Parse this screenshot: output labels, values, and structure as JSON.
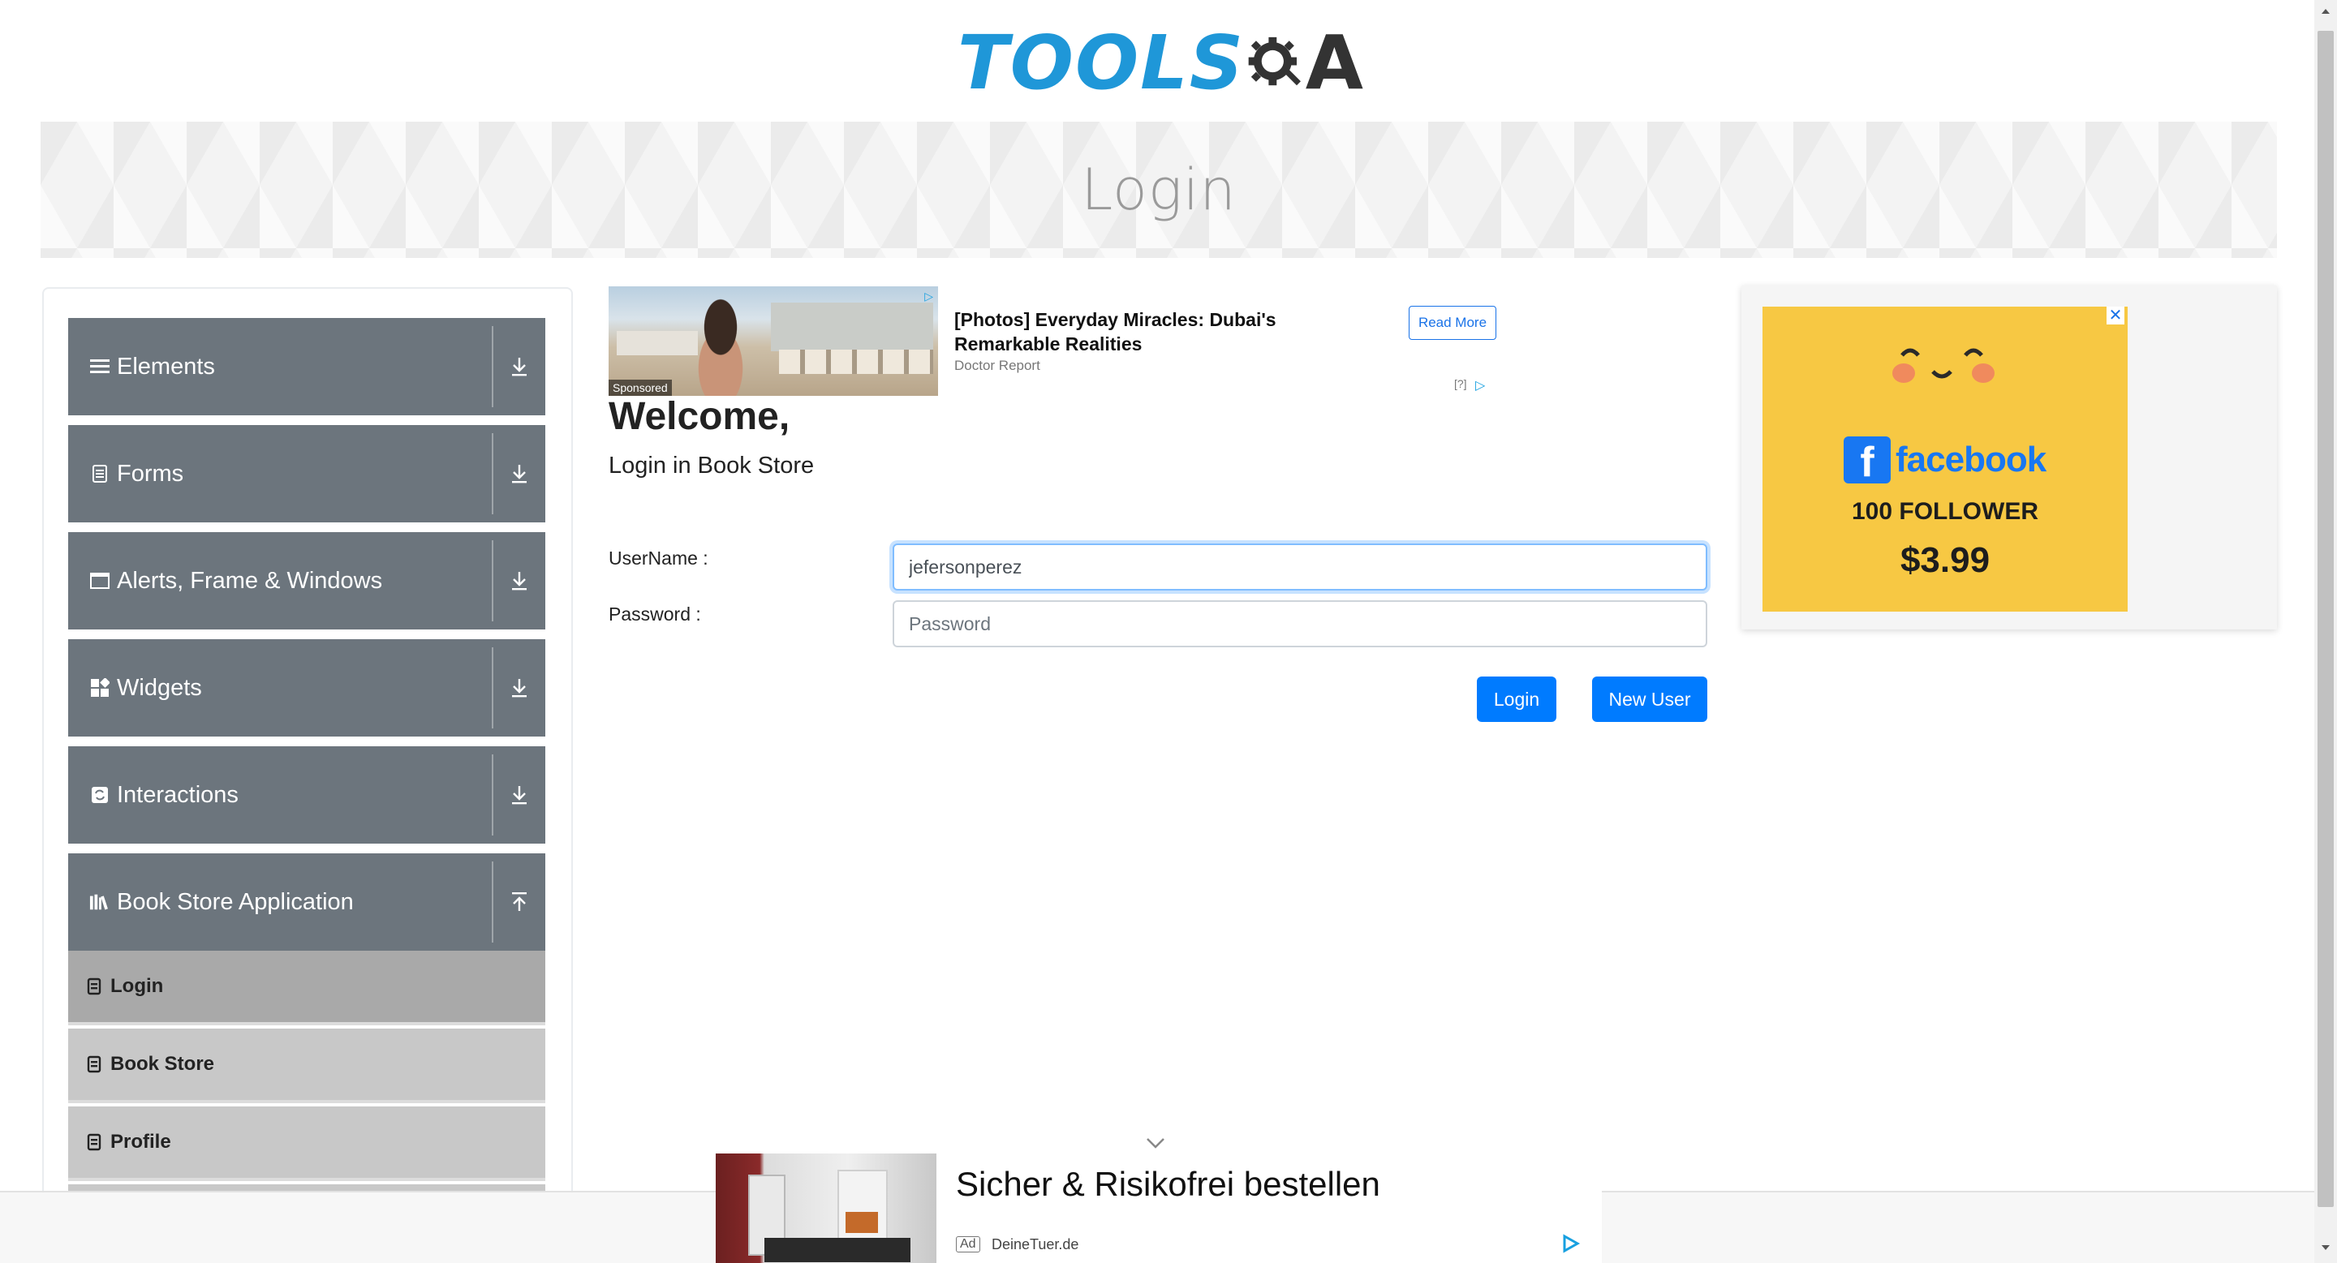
{
  "logo": {
    "text": "TOOLS",
    "a": "A"
  },
  "banner": {
    "title": "Login"
  },
  "sidebar": {
    "groups": [
      {
        "label": "Elements",
        "icon": "hamburger-icon"
      },
      {
        "label": "Forms",
        "icon": "form-icon"
      },
      {
        "label": "Alerts, Frame & Windows",
        "icon": "window-icon"
      },
      {
        "label": "Widgets",
        "icon": "widgets-icon"
      },
      {
        "label": "Interactions",
        "icon": "interactions-icon"
      },
      {
        "label": "Book Store Application",
        "icon": "books-icon"
      }
    ],
    "bookstore_items": [
      {
        "label": "Login",
        "active": true
      },
      {
        "label": "Book Store",
        "active": false
      },
      {
        "label": "Profile",
        "active": false
      }
    ]
  },
  "top_ad": {
    "headline": "[Photos] Everyday Miracles: Dubai's Remarkable Realities",
    "source": "Doctor Report",
    "button": "Read More",
    "sponsored": "Sponsored",
    "info": "[?]"
  },
  "main": {
    "welcome": "Welcome,",
    "subtitle": "Login in Book Store",
    "username_label": "UserName :",
    "password_label": "Password :",
    "username_value": "jefersonperez",
    "password_placeholder": "Password",
    "login_button": "Login",
    "new_user_button": "New User"
  },
  "right_ad": {
    "brand": "facebook",
    "f_letter": "f",
    "followers": "100 FOLLOWER",
    "price": "$3.99",
    "close": "✕"
  },
  "bottom_ad": {
    "headline": "Sicher & Risikofrei bestellen",
    "tag": "Ad",
    "source": "DeineTuer.de"
  },
  "colors": {
    "accent": "#007bff",
    "sidebar_group": "#6c757d",
    "subitem": "#c8c8c8",
    "subitem_active": "#a9a9a9",
    "logo_blue": "#1f97d8",
    "fb_yellow": "#f7c843",
    "fb_blue": "#1877f2"
  }
}
